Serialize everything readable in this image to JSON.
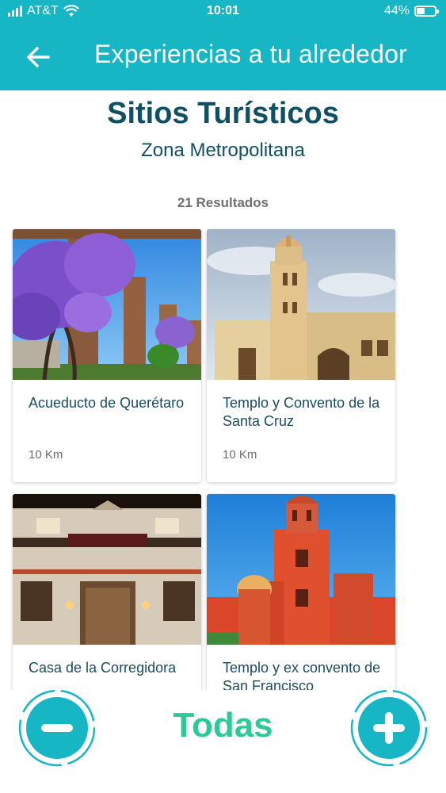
{
  "status_bar": {
    "carrier": "AT&T",
    "time": "10:01",
    "battery_percent": "44%",
    "battery_level": 0.44
  },
  "app_bar": {
    "back_icon": "arrow-left-icon",
    "title": "Experiencias a tu alrededor"
  },
  "header": {
    "title": "Sitios Turísticos",
    "subtitle": "Zona Metropolitana",
    "results": "21 Resultados"
  },
  "places": [
    {
      "name": "Acueducto de Querétaro",
      "distance": "10 Km"
    },
    {
      "name": "Templo y Convento de la Santa Cruz",
      "distance": "10 Km"
    },
    {
      "name": "Casa de la Corregidora",
      "distance": ""
    },
    {
      "name": "Templo y ex convento de San Francisco",
      "distance": ""
    }
  ],
  "footer": {
    "filter_label": "Todas",
    "minus_icon": "minus-icon",
    "plus_icon": "plus-icon"
  },
  "colors": {
    "accent": "#16b6c4",
    "heading": "#114f63",
    "filter_green": "#2ccb96"
  }
}
